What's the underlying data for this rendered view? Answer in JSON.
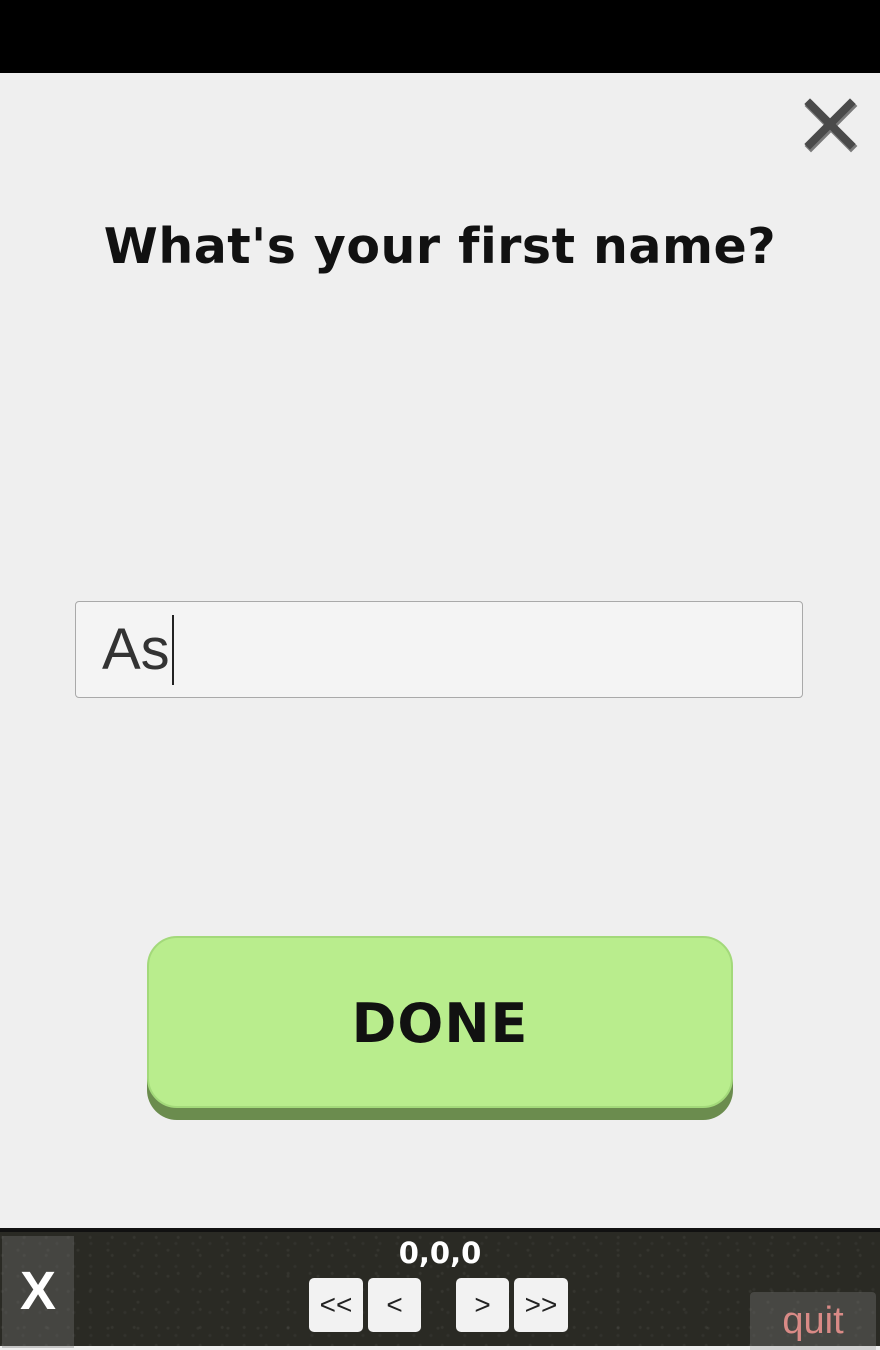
{
  "dialog": {
    "question": "What's your first name?",
    "name_value": "As",
    "done_label": "DONE",
    "close_icon": "close-icon"
  },
  "debug_bar": {
    "x_label": "X",
    "counter": "0,0,0",
    "first_label": "<<",
    "prev_label": "<",
    "next_label": ">",
    "last_label": ">>",
    "quit_label": "quit"
  },
  "colors": {
    "done_button": "#b9ed8d",
    "done_shadow": "#6b8c4e",
    "quit_text": "#d98a86"
  }
}
